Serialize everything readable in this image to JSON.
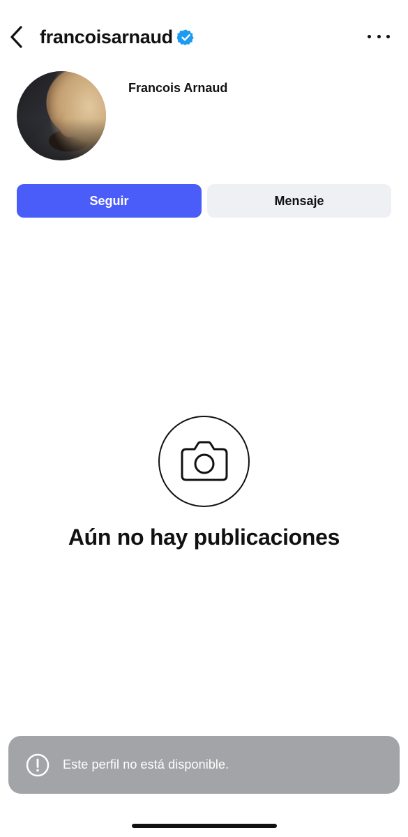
{
  "header": {
    "username": "francoisarnaud",
    "verified": true,
    "back_icon": "chevron-left-icon",
    "more_icon": "more-horizontal-icon",
    "verified_color": "#1d9bf0"
  },
  "profile": {
    "display_name": "Francois Arnaud"
  },
  "actions": {
    "follow_label": "Seguir",
    "message_label": "Mensaje",
    "follow_color": "#4a5df9"
  },
  "empty_state": {
    "icon": "camera-icon",
    "title": "Aún no hay publicaciones"
  },
  "toast": {
    "icon": "alert-circle-icon",
    "message": "Este perfil no está disponible."
  }
}
